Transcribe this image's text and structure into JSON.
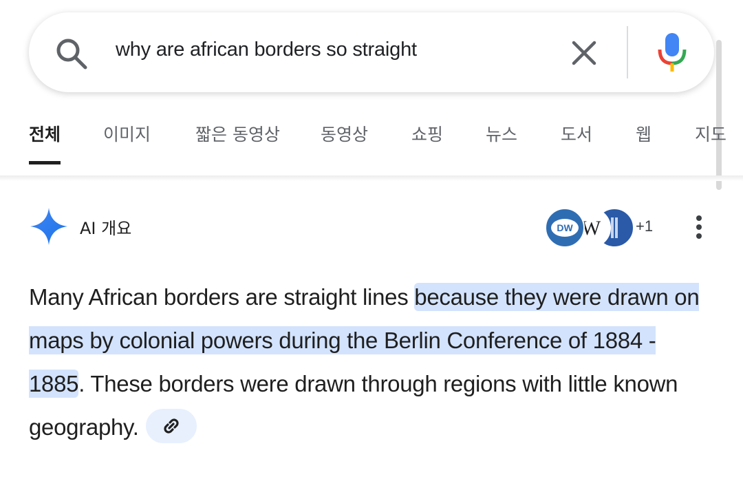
{
  "search": {
    "query": "why are african borders so straight",
    "icons": {
      "search": "search-icon",
      "clear": "close-icon",
      "voice": "mic-icon"
    }
  },
  "tabs": [
    {
      "label": "전체",
      "active": true
    },
    {
      "label": "이미지"
    },
    {
      "label": "짧은 동영상"
    },
    {
      "label": "동영상"
    },
    {
      "label": "쇼핑"
    },
    {
      "label": "뉴스"
    },
    {
      "label": "도서"
    },
    {
      "label": "웹"
    },
    {
      "label": "지도"
    }
  ],
  "ai_overview": {
    "label": "AI 개요",
    "sources": [
      {
        "name": "DW",
        "icon": "dw-logo"
      },
      {
        "name": "W",
        "icon": "wikipedia-logo"
      },
      {
        "name": "Britannica",
        "icon": "britannica-logo"
      }
    ],
    "more_sources": "+1",
    "answer": {
      "part1": "Many African borders are straight lines ",
      "highlight": "because they were drawn on maps by colonial powers during the Berlin Conference of 1884 - 1885",
      "part2": ". These borders were drawn through regions with little known geography."
    }
  },
  "colors": {
    "highlight": "#d3e3fd",
    "chip": "#e8f0fe",
    "accent_blue": "#4285f4"
  }
}
